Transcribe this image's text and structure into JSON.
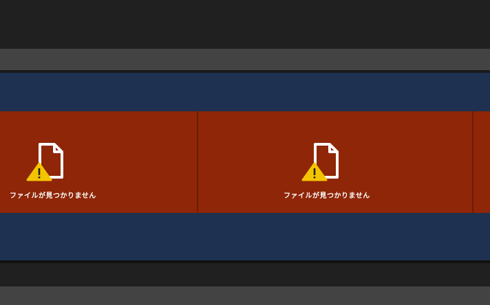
{
  "timeline": {
    "clips": [
      {
        "status_label": "ファイルが見つかりません",
        "icon": "missing-file-icon"
      },
      {
        "status_label": "ファイルが見つかりません",
        "icon": "missing-file-icon"
      }
    ]
  },
  "colors": {
    "clip_missing": "#8e2607",
    "track": "#1e3150",
    "ruler": "#434343",
    "background": "#202020",
    "warning": "#f5c400"
  }
}
